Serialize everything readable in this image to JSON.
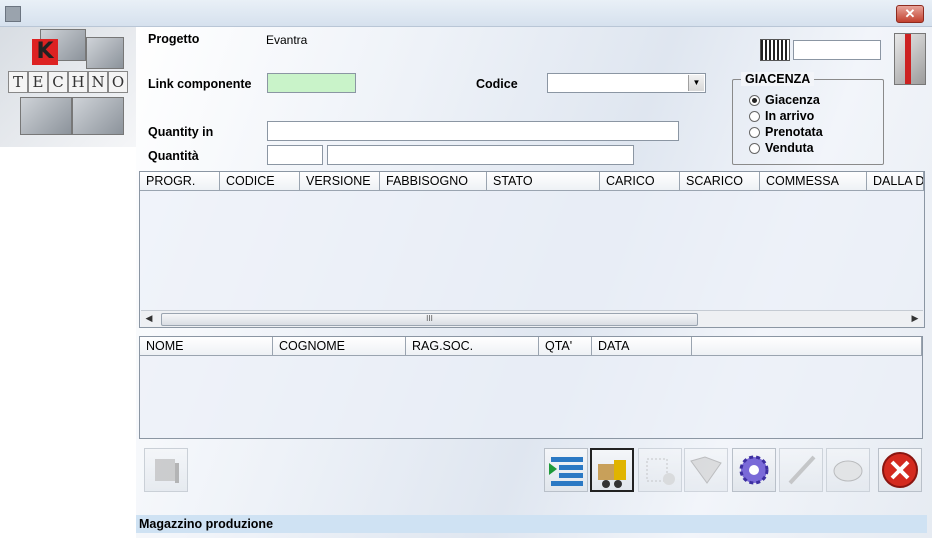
{
  "window": {
    "close_label": "✕"
  },
  "logo": {
    "k": "K",
    "letters": [
      "T",
      "E",
      "C",
      "H",
      "N",
      "O"
    ]
  },
  "form": {
    "progetto_label": "Progetto",
    "progetto_value": "Evantra",
    "link_label": "Link componente",
    "link_value": "",
    "codice_label": "Codice",
    "codice_value": "",
    "quantity_in_label": "Quantity in",
    "quantity_in_value": "",
    "quantita_label": "Quantità",
    "quantita_value1": "",
    "quantita_value2": "",
    "barcode_value": ""
  },
  "giacenza": {
    "title": "GIACENZA",
    "options": [
      {
        "label": "Giacenza",
        "selected": true
      },
      {
        "label": "In arrivo",
        "selected": false
      },
      {
        "label": "Prenotata",
        "selected": false
      },
      {
        "label": "Venduta",
        "selected": false
      }
    ]
  },
  "grid1": {
    "columns": [
      "PROGR.",
      "CODICE",
      "VERSIONE",
      "FABBISOGNO",
      "STATO",
      "CARICO",
      "SCARICO",
      "COMMESSA",
      "DALLA D"
    ],
    "scroll_grip": "III"
  },
  "grid2": {
    "columns": [
      "NOME",
      "COGNOME",
      "RAG.SOC.",
      "QTA'",
      "DATA",
      ""
    ]
  },
  "status": {
    "text": "Magazzino produzione"
  },
  "colors": {
    "accent_green": "#c9f3c9",
    "status_bar": "#cfe2f3",
    "close_red": "#c2412f"
  }
}
